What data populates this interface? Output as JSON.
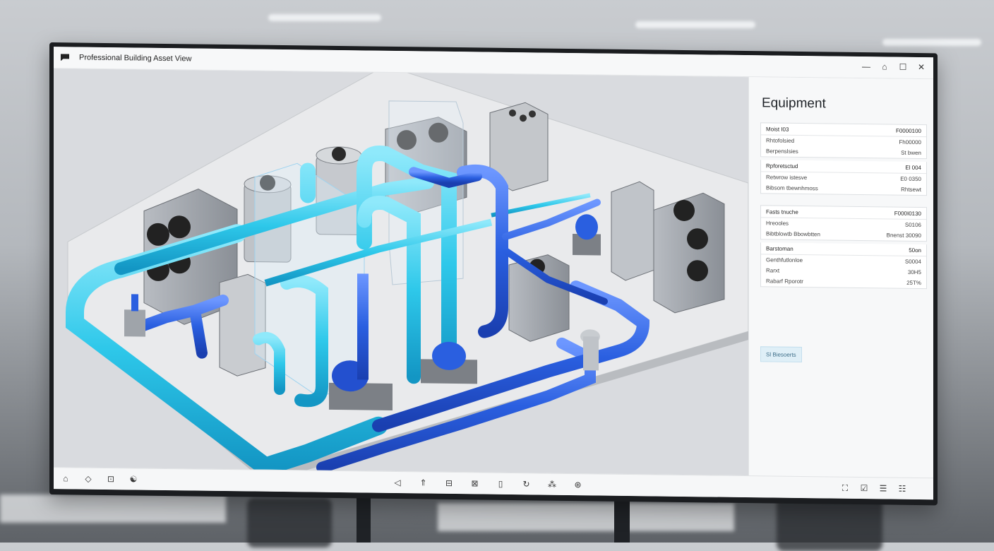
{
  "window": {
    "title": "Professional Building Asset View",
    "controls": [
      {
        "name": "minimize-button",
        "glyph": "—"
      },
      {
        "name": "settings-button",
        "glyph": "⌂"
      },
      {
        "name": "maximize-button",
        "glyph": "☐"
      },
      {
        "name": "close-button",
        "glyph": "✕"
      }
    ]
  },
  "panel": {
    "title": "Equipment",
    "sections": [
      {
        "header": {
          "label": "Moist I03",
          "value": "F0000100"
        },
        "rows": [
          {
            "label": "Rhtofolsied",
            "value": "Fh00000"
          },
          {
            "label": "Berpenslsies",
            "value": "St bwen"
          }
        ]
      },
      {
        "header": {
          "label": "Rpforetsctud",
          "value": "El 004"
        },
        "rows": [
          {
            "label": "Retwrow istesve",
            "value": "E0 0350"
          },
          {
            "label": "Bibsom tbewnhmoss",
            "value": "Rhtsewt"
          }
        ]
      },
      {
        "header": {
          "label": "Fasts tnuche",
          "value": "F000I0130"
        },
        "rows": [
          {
            "label": "Hreooles",
            "value": "S0106"
          },
          {
            "label": "Bibtblowtb Bbowbtten",
            "value": "Bnenst 30090"
          }
        ]
      },
      {
        "header": {
          "label": "Barstoman",
          "value": "50on"
        },
        "rows": [
          {
            "label": "Genthfutlonloe",
            "value": "S0004"
          },
          {
            "label": "Rarxt",
            "value": "30H5"
          },
          {
            "label": "Rabarf Rporotr",
            "value": "25T%"
          }
        ]
      }
    ],
    "action_button": "Sl Biesoerts"
  },
  "toolbar": {
    "left": [
      {
        "name": "home-tool-icon",
        "glyph": "⌂"
      },
      {
        "name": "navigate-tool-icon",
        "glyph": "◇"
      },
      {
        "name": "frame-tool-icon",
        "glyph": "⊡"
      },
      {
        "name": "orbit-tool-icon",
        "glyph": "☯"
      }
    ],
    "center": [
      {
        "name": "select-tool-icon",
        "glyph": "◁"
      },
      {
        "name": "pan-tool-icon",
        "glyph": "⇑"
      },
      {
        "name": "section-tool-icon",
        "glyph": "⊟"
      },
      {
        "name": "zoom-tool-icon",
        "glyph": "⊠"
      },
      {
        "name": "clipboard-tool-icon",
        "glyph": "▯"
      },
      {
        "name": "rotate-tool-icon",
        "glyph": "↻"
      },
      {
        "name": "layers-tool-icon",
        "glyph": "⁂"
      },
      {
        "name": "measure-tool-icon",
        "glyph": "⊛"
      }
    ],
    "right": [
      {
        "name": "fit-view-icon",
        "glyph": "⛶"
      },
      {
        "name": "edit-icon",
        "glyph": "☑"
      },
      {
        "name": "properties-icon",
        "glyph": "☰"
      },
      {
        "name": "list-icon",
        "glyph": "☷"
      }
    ]
  },
  "colors": {
    "pipe_cyan": "#2ec8ea",
    "pipe_blue": "#2a5fe0",
    "equipment_gray": "#9ea3a9"
  }
}
